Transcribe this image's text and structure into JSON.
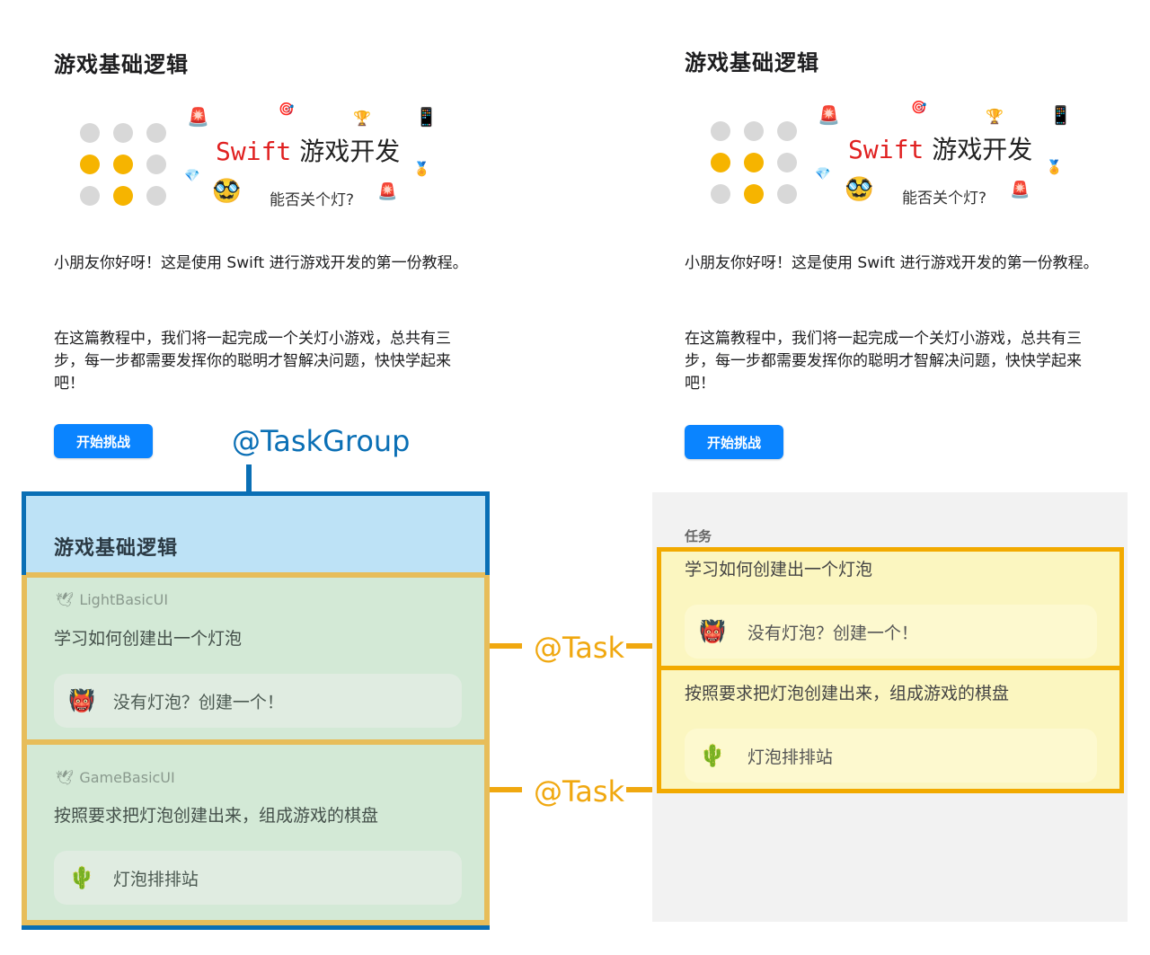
{
  "left": {
    "title": "游戏基础逻辑",
    "banner": {
      "swift": "Swift",
      "title": " 游戏开发",
      "subtitle": "能否关个灯?"
    },
    "intro": "小朋友你好呀！这是使用 Swift 进行游戏开发的第一份教程。",
    "description": "在这篇教程中，我们将一起完成一个关灯小游戏，总共有三步，每一步都需要发挥你的聪明才智解决问题，快快学起来吧！",
    "start_button": "开始挑战",
    "task_group": {
      "title": "游戏基础逻辑",
      "tasks": [
        {
          "chapter": "LightBasicUI",
          "title": "学习如何创建出一个灯泡",
          "card": "没有灯泡？创建一个！",
          "icon": "red-creature-icon"
        },
        {
          "chapter": "GameBasicUI",
          "title": "按照要求把灯泡创建出来，组成游戏的棋盘",
          "card": "灯泡排排站",
          "icon": "green-creature-icon"
        }
      ]
    }
  },
  "annotations": {
    "task_group": "@TaskGroup",
    "task_1": "@Task",
    "task_2": "@Task"
  },
  "right": {
    "title": "游戏基础逻辑",
    "banner": {
      "swift": "Swift",
      "title": " 游戏开发",
      "subtitle": "能否关个灯?"
    },
    "intro": "小朋友你好呀！这是使用 Swift 进行游戏开发的第一份教程。",
    "description": "在这篇教程中，我们将一起完成一个关灯小游戏，总共有三步，每一步都需要发挥你的聪明才智解决问题，快快学起来吧！",
    "start_button": "开始挑战",
    "section_label": "任务",
    "tasks": [
      {
        "title": "学习如何创建出一个灯泡",
        "card": "没有灯泡？创建一个！",
        "icon": "red-creature-icon"
      },
      {
        "title": "按照要求把灯泡创建出来，组成游戏的棋盘",
        "card": "灯泡排排站",
        "icon": "green-creature-icon"
      }
    ]
  },
  "colors": {
    "accent_blue": "#0a84ff",
    "swift_red": "#e02020",
    "task_orange": "#f2aa00",
    "taskgroup_blue": "#0a6fb5",
    "light_on": "#f6b400"
  }
}
